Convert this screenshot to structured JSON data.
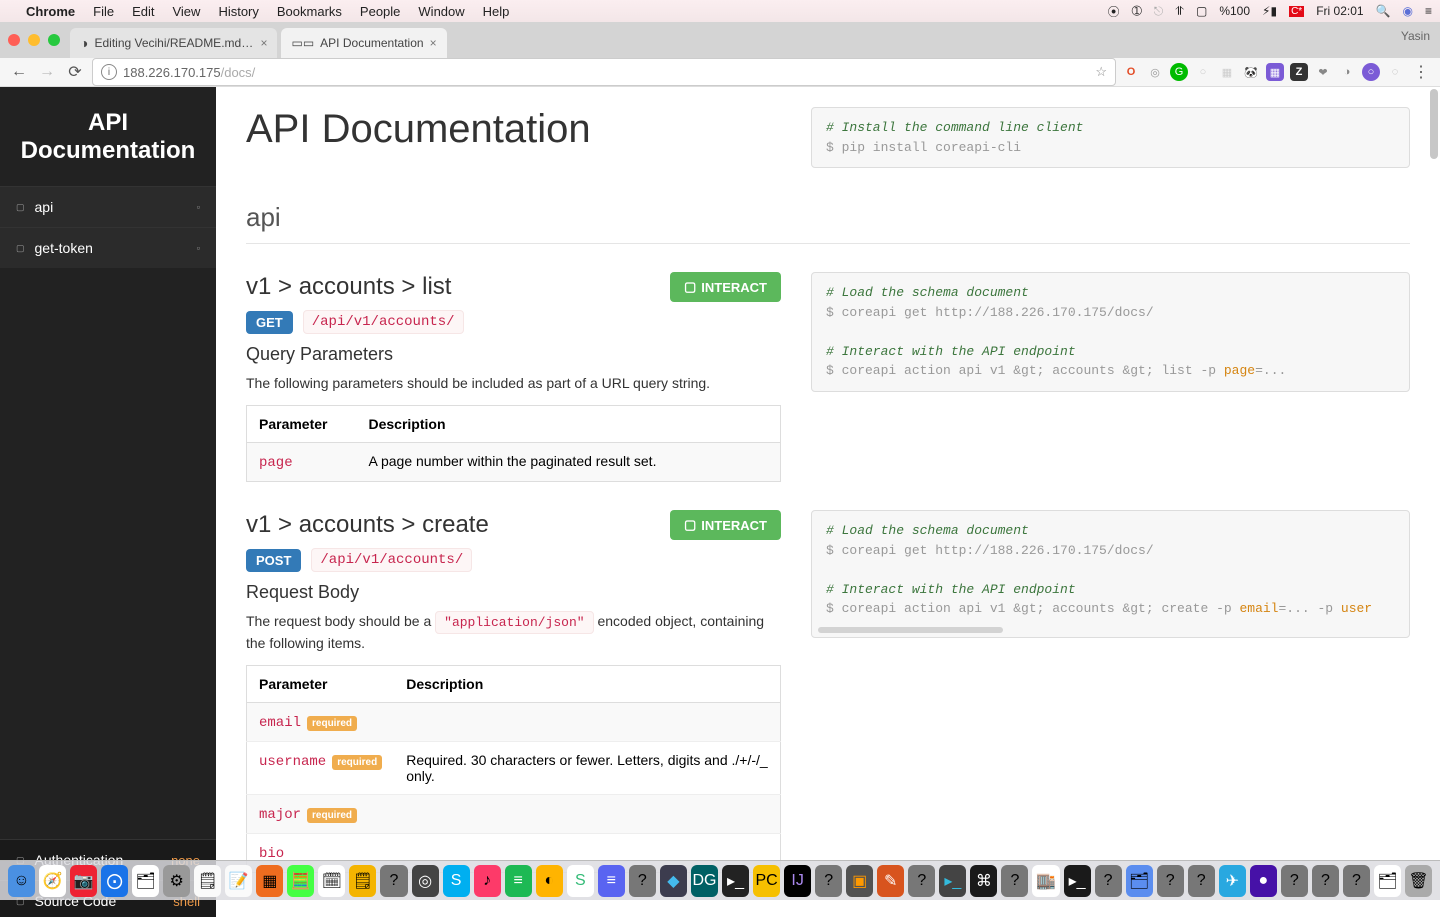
{
  "menubar": {
    "app": "Chrome",
    "items": [
      "File",
      "Edit",
      "View",
      "History",
      "Bookmarks",
      "People",
      "Window",
      "Help"
    ],
    "battery": "%100",
    "clock": "Fri 02:01"
  },
  "chrome": {
    "profile": "Yasin",
    "tabs": [
      {
        "title": "Editing Vecihi/README.md at r",
        "active": false
      },
      {
        "title": "API Documentation",
        "active": true
      }
    ],
    "url_host": "188.226.170.175",
    "url_path": "/docs/"
  },
  "sidebar": {
    "title": "API Documentation",
    "items": [
      {
        "label": "api"
      },
      {
        "label": "get-token"
      }
    ],
    "footer": [
      {
        "label": "Authentication",
        "value": "none"
      },
      {
        "label": "Source Code",
        "value": "shell"
      }
    ]
  },
  "page": {
    "title": "API Documentation",
    "section": "api",
    "install_comment": "# Install the command line client",
    "install_cmd": "$ pip install coreapi-cli"
  },
  "endpoints": [
    {
      "heading": "v1 > accounts > list",
      "interact": "INTERACT",
      "method": "GET",
      "url": "/api/v1/accounts/",
      "subhead": "Query Parameters",
      "desc": "The following parameters should be included as part of a URL query string.",
      "cols": [
        "Parameter",
        "Description"
      ],
      "rows": [
        {
          "name": "page",
          "required": false,
          "desc": "A page number within the paginated result set."
        }
      ],
      "code": {
        "c1": "# Load the schema document",
        "l1": "$ coreapi get http://188.226.170.175/docs/",
        "c2": "# Interact with the API endpoint",
        "l2a": "$ coreapi action api v1 &gt; accounts &gt; list -p ",
        "l2kw": "page",
        "l2b": "=...",
        "scroll": false
      }
    },
    {
      "heading": "v1 > accounts > create",
      "interact": "INTERACT",
      "method": "POST",
      "url": "/api/v1/accounts/",
      "subhead": "Request Body",
      "desc_pre": "The request body should be a ",
      "desc_code": "\"application/json\"",
      "desc_post": " encoded object, containing the following items.",
      "cols": [
        "Parameter",
        "Description"
      ],
      "rows": [
        {
          "name": "email",
          "required": true,
          "desc": ""
        },
        {
          "name": "username",
          "required": true,
          "desc": "Required. 30 characters or fewer. Letters, digits and ./+/-/_ only."
        },
        {
          "name": "major",
          "required": true,
          "desc": ""
        },
        {
          "name": "bio",
          "required": false,
          "desc": ""
        }
      ],
      "code": {
        "c1": "# Load the schema document",
        "l1": "$ coreapi get http://188.226.170.175/docs/",
        "c2": "# Interact with the API endpoint",
        "l2a": "$ coreapi action api v1 &gt; accounts &gt; create -p ",
        "l2kw": "email",
        "l2b": "=... -p ",
        "l2kw2": "user",
        "scroll": true
      }
    }
  ],
  "labels": {
    "required": "required"
  }
}
